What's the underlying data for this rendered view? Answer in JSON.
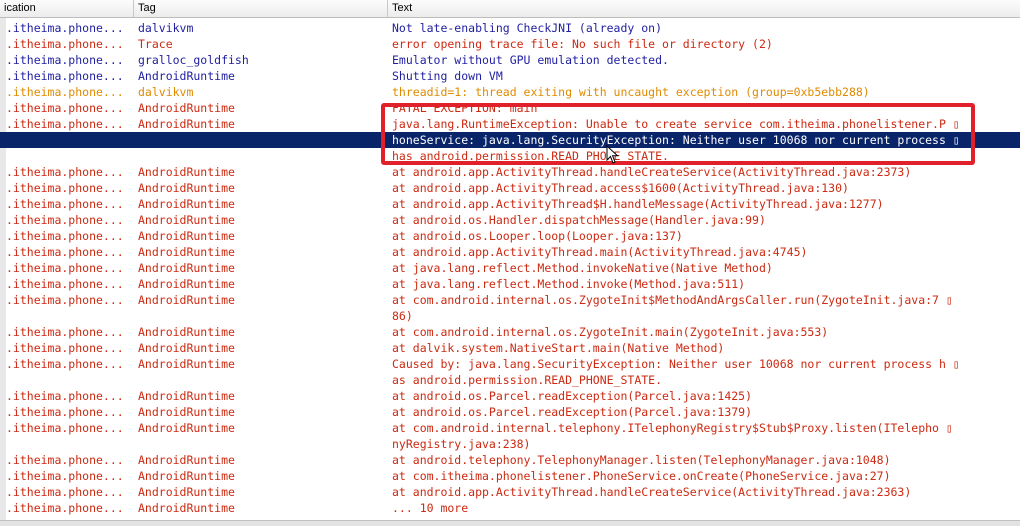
{
  "columns": {
    "application": "ication",
    "tag": "Tag",
    "text": "Text"
  },
  "colors": {
    "info": "#1f1fa0",
    "error": "#cc2a12",
    "warning": "#e08a00",
    "selected_bg": "#0a246a",
    "highlight_box": "#e0202a"
  },
  "rows": [
    {
      "app": ".itheima.phone...",
      "tag": "dalvikvm",
      "text": "Not late-enabling CheckJNI (already on)",
      "level": "info"
    },
    {
      "app": ".itheima.phone...",
      "tag": "Trace",
      "text": "error opening trace file: No such file or directory (2)",
      "level": "error"
    },
    {
      "app": ".itheima.phone...",
      "tag": "gralloc_goldfish",
      "text": "Emulator without GPU emulation detected.",
      "level": "info"
    },
    {
      "app": ".itheima.phone...",
      "tag": "AndroidRuntime",
      "text": "Shutting down VM",
      "level": "info"
    },
    {
      "app": ".itheima.phone...",
      "tag": "dalvikvm",
      "text": "threadid=1: thread exiting with uncaught exception (group=0xb5ebb288)",
      "level": "warning"
    },
    {
      "app": ".itheima.phone...",
      "tag": "AndroidRuntime",
      "text": "FATAL EXCEPTION: main",
      "level": "error"
    },
    {
      "app": ".itheima.phone...",
      "tag": "AndroidRuntime",
      "text": "java.lang.RuntimeException: Unable to create service com.itheima.phonelistener.P ▯",
      "level": "error"
    },
    {
      "app": "",
      "tag": "",
      "text": "honeService: java.lang.SecurityException: Neither user 10068 nor current process ▯",
      "level": "selected"
    },
    {
      "app": "",
      "tag": "",
      "text": " has android.permission.READ_PHONE_STATE.",
      "level": "error"
    },
    {
      "app": ".itheima.phone...",
      "tag": "AndroidRuntime",
      "text": "at android.app.ActivityThread.handleCreateService(ActivityThread.java:2373)",
      "level": "error"
    },
    {
      "app": ".itheima.phone...",
      "tag": "AndroidRuntime",
      "text": "at android.app.ActivityThread.access$1600(ActivityThread.java:130)",
      "level": "error"
    },
    {
      "app": ".itheima.phone...",
      "tag": "AndroidRuntime",
      "text": "at android.app.ActivityThread$H.handleMessage(ActivityThread.java:1277)",
      "level": "error"
    },
    {
      "app": ".itheima.phone...",
      "tag": "AndroidRuntime",
      "text": "at android.os.Handler.dispatchMessage(Handler.java:99)",
      "level": "error"
    },
    {
      "app": ".itheima.phone...",
      "tag": "AndroidRuntime",
      "text": "at android.os.Looper.loop(Looper.java:137)",
      "level": "error"
    },
    {
      "app": ".itheima.phone...",
      "tag": "AndroidRuntime",
      "text": "at android.app.ActivityThread.main(ActivityThread.java:4745)",
      "level": "error"
    },
    {
      "app": ".itheima.phone...",
      "tag": "AndroidRuntime",
      "text": "at java.lang.reflect.Method.invokeNative(Native Method)",
      "level": "error"
    },
    {
      "app": ".itheima.phone...",
      "tag": "AndroidRuntime",
      "text": "at java.lang.reflect.Method.invoke(Method.java:511)",
      "level": "error"
    },
    {
      "app": ".itheima.phone...",
      "tag": "AndroidRuntime",
      "text": "at com.android.internal.os.ZygoteInit$MethodAndArgsCaller.run(ZygoteInit.java:7 ▯",
      "level": "error"
    },
    {
      "app": "",
      "tag": "",
      "text": "86)",
      "level": "error"
    },
    {
      "app": ".itheima.phone...",
      "tag": "AndroidRuntime",
      "text": "at com.android.internal.os.ZygoteInit.main(ZygoteInit.java:553)",
      "level": "error"
    },
    {
      "app": ".itheima.phone...",
      "tag": "AndroidRuntime",
      "text": "at dalvik.system.NativeStart.main(Native Method)",
      "level": "error"
    },
    {
      "app": ".itheima.phone...",
      "tag": "AndroidRuntime",
      "text": "Caused by: java.lang.SecurityException: Neither user 10068 nor current process h ▯",
      "level": "error"
    },
    {
      "app": "",
      "tag": "",
      "text": "as android.permission.READ_PHONE_STATE.",
      "level": "error"
    },
    {
      "app": ".itheima.phone...",
      "tag": "AndroidRuntime",
      "text": "at android.os.Parcel.readException(Parcel.java:1425)",
      "level": "error"
    },
    {
      "app": ".itheima.phone...",
      "tag": "AndroidRuntime",
      "text": "at android.os.Parcel.readException(Parcel.java:1379)",
      "level": "error"
    },
    {
      "app": ".itheima.phone...",
      "tag": "AndroidRuntime",
      "text": "at com.android.internal.telephony.ITelephonyRegistry$Stub$Proxy.listen(ITelepho ▯",
      "level": "error"
    },
    {
      "app": "",
      "tag": "",
      "text": "nyRegistry.java:238)",
      "level": "error"
    },
    {
      "app": ".itheima.phone...",
      "tag": "AndroidRuntime",
      "text": "at android.telephony.TelephonyManager.listen(TelephonyManager.java:1048)",
      "level": "error"
    },
    {
      "app": ".itheima.phone...",
      "tag": "AndroidRuntime",
      "text": "at com.itheima.phonelistener.PhoneService.onCreate(PhoneService.java:27)",
      "level": "error"
    },
    {
      "app": ".itheima.phone...",
      "tag": "AndroidRuntime",
      "text": "at android.app.ActivityThread.handleCreateService(ActivityThread.java:2363)",
      "level": "error"
    },
    {
      "app": ".itheima.phone...",
      "tag": "AndroidRuntime",
      "text": "... 10 more",
      "level": "error"
    }
  ]
}
